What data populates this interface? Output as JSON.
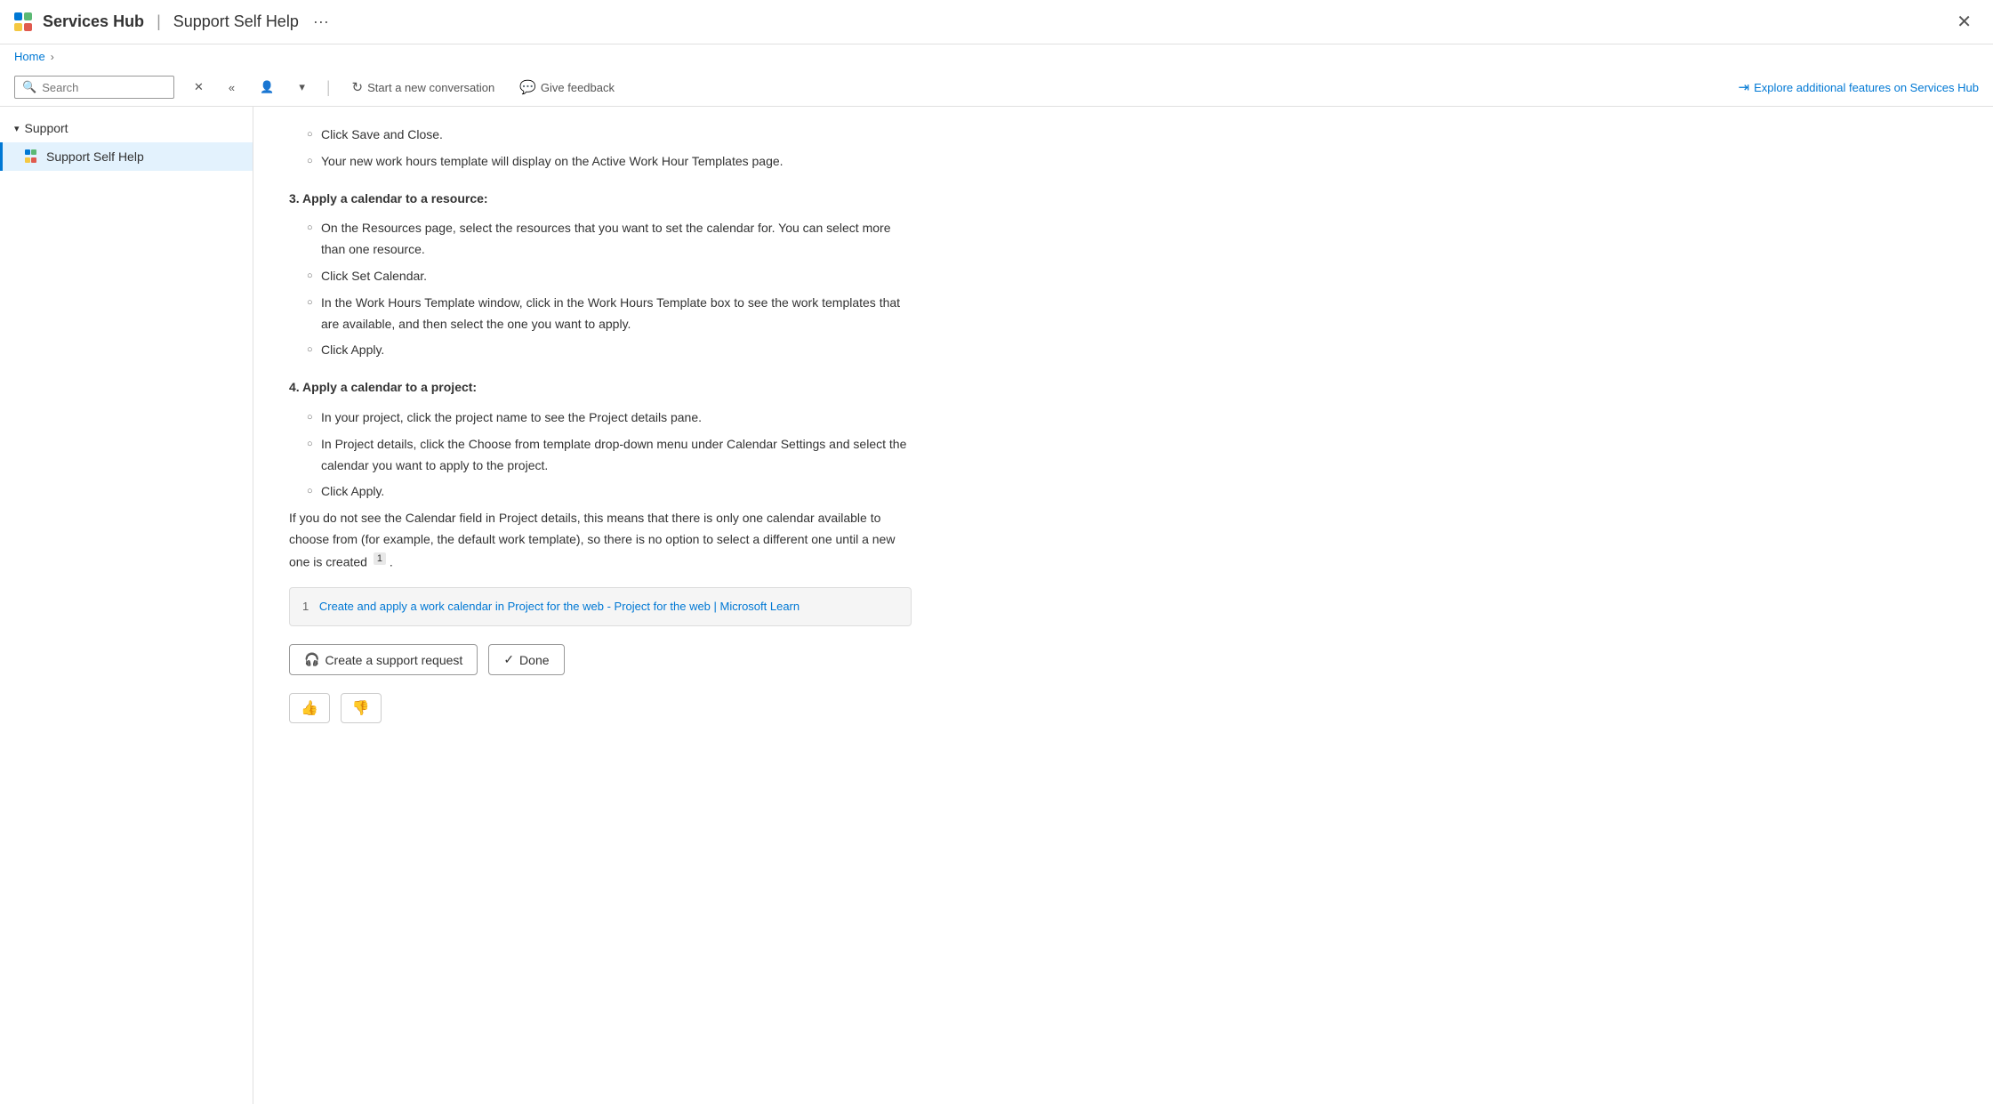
{
  "titleBar": {
    "appTitle": "Services Hub",
    "separator": "|",
    "subtitle": "Support Self Help",
    "ellipsisLabel": "···",
    "closeLabel": "✕"
  },
  "breadcrumb": {
    "homeLabel": "Home",
    "separator": "›"
  },
  "toolbar": {
    "searchPlaceholder": "Search",
    "clearLabel": "✕",
    "backLabel": "«",
    "personLabel": "👤",
    "dropdownLabel": "▾",
    "newConversationLabel": "Start a new conversation",
    "feedbackLabel": "Give feedback",
    "exploreLabel": "Explore additional features on Services Hub"
  },
  "sidebar": {
    "groupLabel": "Support",
    "itemLabel": "Support Self Help"
  },
  "article": {
    "step1a": "Click Save and Close.",
    "step1b": "Your new work hours template will display on the Active Work Hour Templates page.",
    "section3Title": "3. Apply a calendar to a resource:",
    "step3a": "On the Resources page, select the resources that you want to set the calendar for. You can select more than one resource.",
    "step3b": "Click Set Calendar.",
    "step3c": "In the Work Hours Template window, click in the Work Hours Template box to see the work templates that are available, and then select the one you want to apply.",
    "step3d": "Click Apply.",
    "section4Title": "4. Apply a calendar to a project:",
    "step4a": "In your project, click the project name to see the Project details pane.",
    "step4b": "In Project details, click the Choose from template drop-down menu under Calendar Settings and select the calendar you want to apply to the project.",
    "step4c": "Click Apply.",
    "noteText": "If you do not see the Calendar field in Project details, this means that there is only one calendar available to choose from (for example, the default work template), so there is no option to select a different one until a new one is created",
    "footnoteRef": "1",
    "footnotePeriod": ".",
    "footnoteNum": "1",
    "footnoteText": "Create and apply a work calendar in Project for the web - Project for the web | Microsoft Learn",
    "createSupportLabel": "Create a support request",
    "doneLabel": "Done",
    "thumbUpLabel": "👍",
    "thumbDownLabel": "👎"
  },
  "colors": {
    "accent": "#0078d4",
    "activeBorder": "#0078d4",
    "activeBackground": "#e3f2fd"
  }
}
